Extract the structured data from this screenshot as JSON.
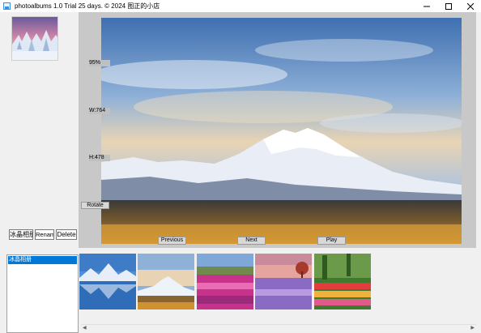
{
  "window": {
    "title": "photoalbums 1.0 Trial 25 days. © 2024 图正的小店",
    "minimize": "—",
    "maximize": "☐",
    "close": "✕"
  },
  "left_panel": {
    "thumbnail": "snowy-forest-sunset",
    "buttons": {
      "album": "冰晶相册",
      "rename": "Rename",
      "delete": "Delete"
    }
  },
  "viewer": {
    "image": "mountain-sunrise",
    "zoom": "95%",
    "width": "W:764",
    "height": "H:478",
    "rotate": "Rotate",
    "previous": "Previous",
    "next": "Next",
    "play": "Play"
  },
  "albums": [
    {
      "name": "冰晶相册",
      "selected": true
    }
  ],
  "thumbnails": [
    {
      "name": "lake-reflection"
    },
    {
      "name": "mountain-sunrise"
    },
    {
      "name": "flower-field-pink"
    },
    {
      "name": "lavender-tree"
    },
    {
      "name": "tulip-garden"
    }
  ],
  "colors": {
    "selection": "#0078d7",
    "viewer_background": "#c8c8c8"
  }
}
